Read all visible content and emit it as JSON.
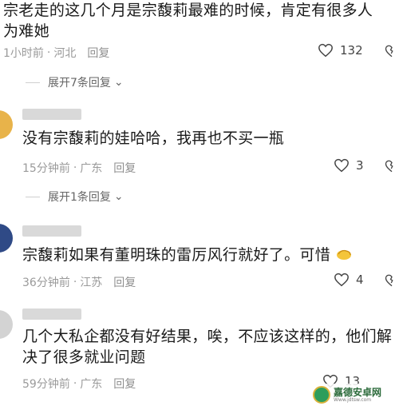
{
  "comments": [
    {
      "text_line1": "宗老走的这几个月是宗馥莉最难的时候，肯定有很多人",
      "text_line2": "为难她",
      "time": "1小时前",
      "location": "河北",
      "reply_label": "回复",
      "likes": "132",
      "expand_label": "展开7条回复"
    },
    {
      "text_line1": "没有宗馥莉的娃哈哈，我再也不买一瓶",
      "time": "15分钟前",
      "location": "广东",
      "reply_label": "回复",
      "likes": "3",
      "expand_label": "展开1条回复"
    },
    {
      "text_line1": "宗馥莉如果有董明珠的雷厉风行就好了。可惜",
      "emoji": "bowing-hand-emoji",
      "time": "36分钟前",
      "location": "江苏",
      "reply_label": "回复",
      "likes": "4"
    },
    {
      "text_line1": "几个大私企都没有好结果，唉，不应该这样的，他们解",
      "text_line2": "决了很多就业问题",
      "time": "59分钟前",
      "location": "广东",
      "reply_label": "回复",
      "likes": "13"
    }
  ],
  "watermark": {
    "title": "嘉德安卓网",
    "subtitle": "Www.jdtsw.com"
  },
  "colors": {
    "text": "#1a1a1a",
    "meta": "#9a9a9a",
    "expand": "#666666"
  }
}
